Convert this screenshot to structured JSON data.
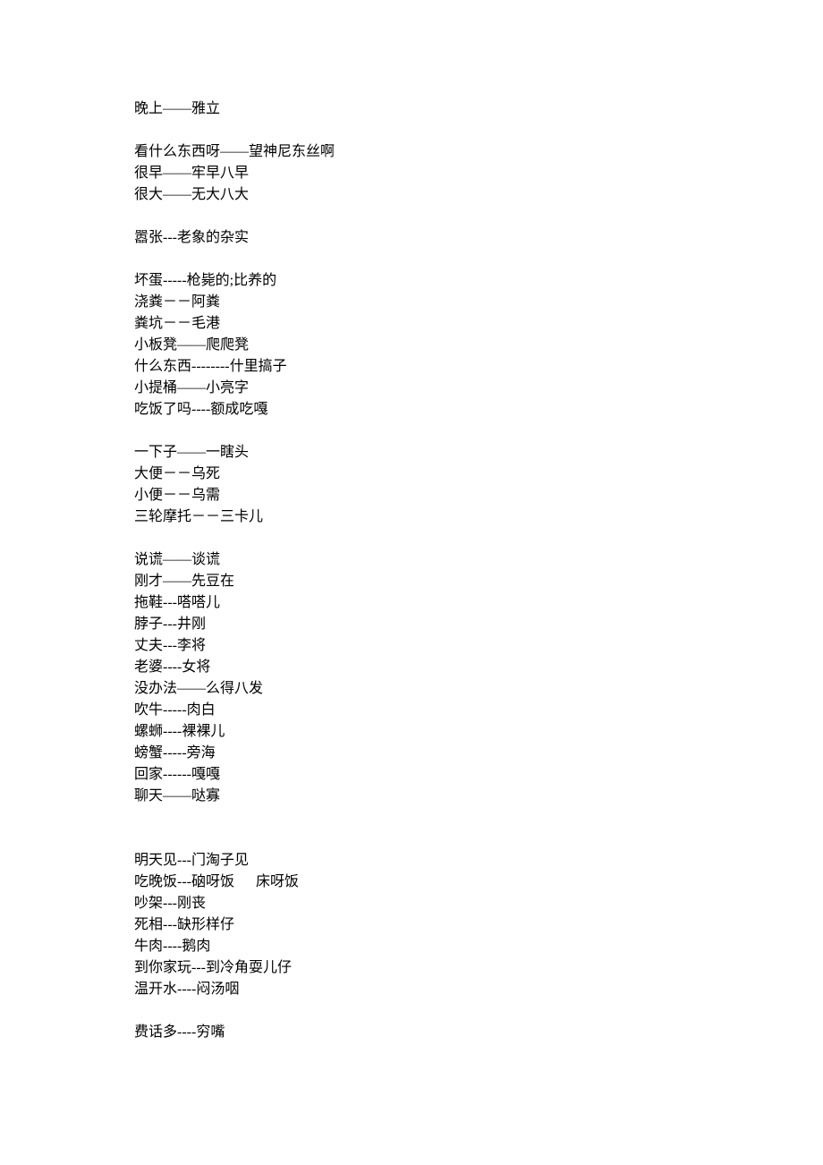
{
  "lines": [
    "晚上——雅立",
    "",
    "看什么东西呀——望神尼东丝啊",
    "很早——牢早八早",
    "很大——无大八大",
    "",
    "嚣张---老象的杂实",
    "",
    "坏蛋-----枪毙的;比养的",
    "浇粪－－阿粪",
    "粪坑－－毛港",
    "小板凳——爬爬凳",
    "什么东西--------什里搞子",
    "小提桶——小亮字",
    "吃饭了吗----额成吃嘎",
    "",
    "一下子——一瞎头",
    "大便－－乌死",
    "小便－－乌需",
    "三轮摩托－－三卡儿",
    "",
    "说谎——谈谎",
    "刚才——先豆在",
    "拖鞋---嗒嗒儿",
    "脖子---井刚",
    "丈夫---李将",
    "老婆----女将",
    "没办法——么得八发",
    "吹牛-----肉白",
    "螺蛳----裸裸儿",
    "螃蟹-----旁海",
    "回家------嘎嘎",
    "聊天——哒寡",
    "",
    "",
    "明天见---门淘子见",
    "吃晚饭---硇呀饭      床呀饭",
    "吵架---刚丧",
    "死相---缺形样仔",
    "牛肉----鹅肉",
    "到你家玩---到冷角耍儿仔",
    "温开水----闷汤咽",
    "",
    "费话多----穷嘴"
  ]
}
